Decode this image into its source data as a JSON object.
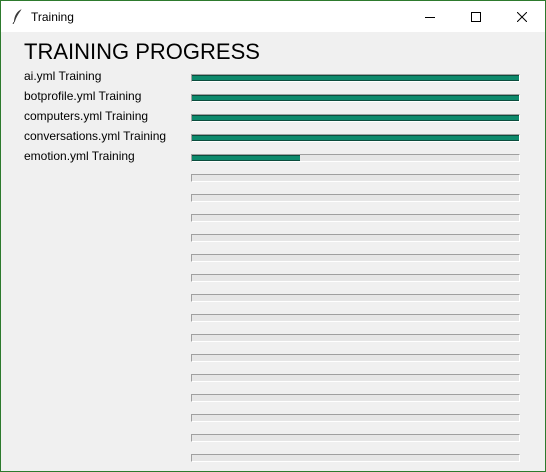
{
  "window": {
    "title": "Training",
    "icon": "feather-icon"
  },
  "heading": "TRAINING PROGRESS",
  "colors": {
    "progress_fill": "#0e8a6c",
    "progress_track": "#e6e6e6",
    "background": "#f0f0f0",
    "frame": "#2d7a2d"
  },
  "rows": [
    {
      "label": "ai.yml Training",
      "progress": 1.0
    },
    {
      "label": "botprofile.yml Training",
      "progress": 1.0
    },
    {
      "label": "computers.yml Training",
      "progress": 1.0
    },
    {
      "label": "conversations.yml Training",
      "progress": 1.0
    },
    {
      "label": "emotion.yml Training",
      "progress": 0.33
    },
    {
      "label": "",
      "progress": 0
    },
    {
      "label": "",
      "progress": 0
    },
    {
      "label": "",
      "progress": 0
    },
    {
      "label": "",
      "progress": 0
    },
    {
      "label": "",
      "progress": 0
    },
    {
      "label": "",
      "progress": 0
    },
    {
      "label": "",
      "progress": 0
    },
    {
      "label": "",
      "progress": 0
    },
    {
      "label": "",
      "progress": 0
    },
    {
      "label": "",
      "progress": 0
    },
    {
      "label": "",
      "progress": 0
    },
    {
      "label": "",
      "progress": 0
    },
    {
      "label": "",
      "progress": 0
    },
    {
      "label": "",
      "progress": 0
    },
    {
      "label": "",
      "progress": 0
    }
  ]
}
